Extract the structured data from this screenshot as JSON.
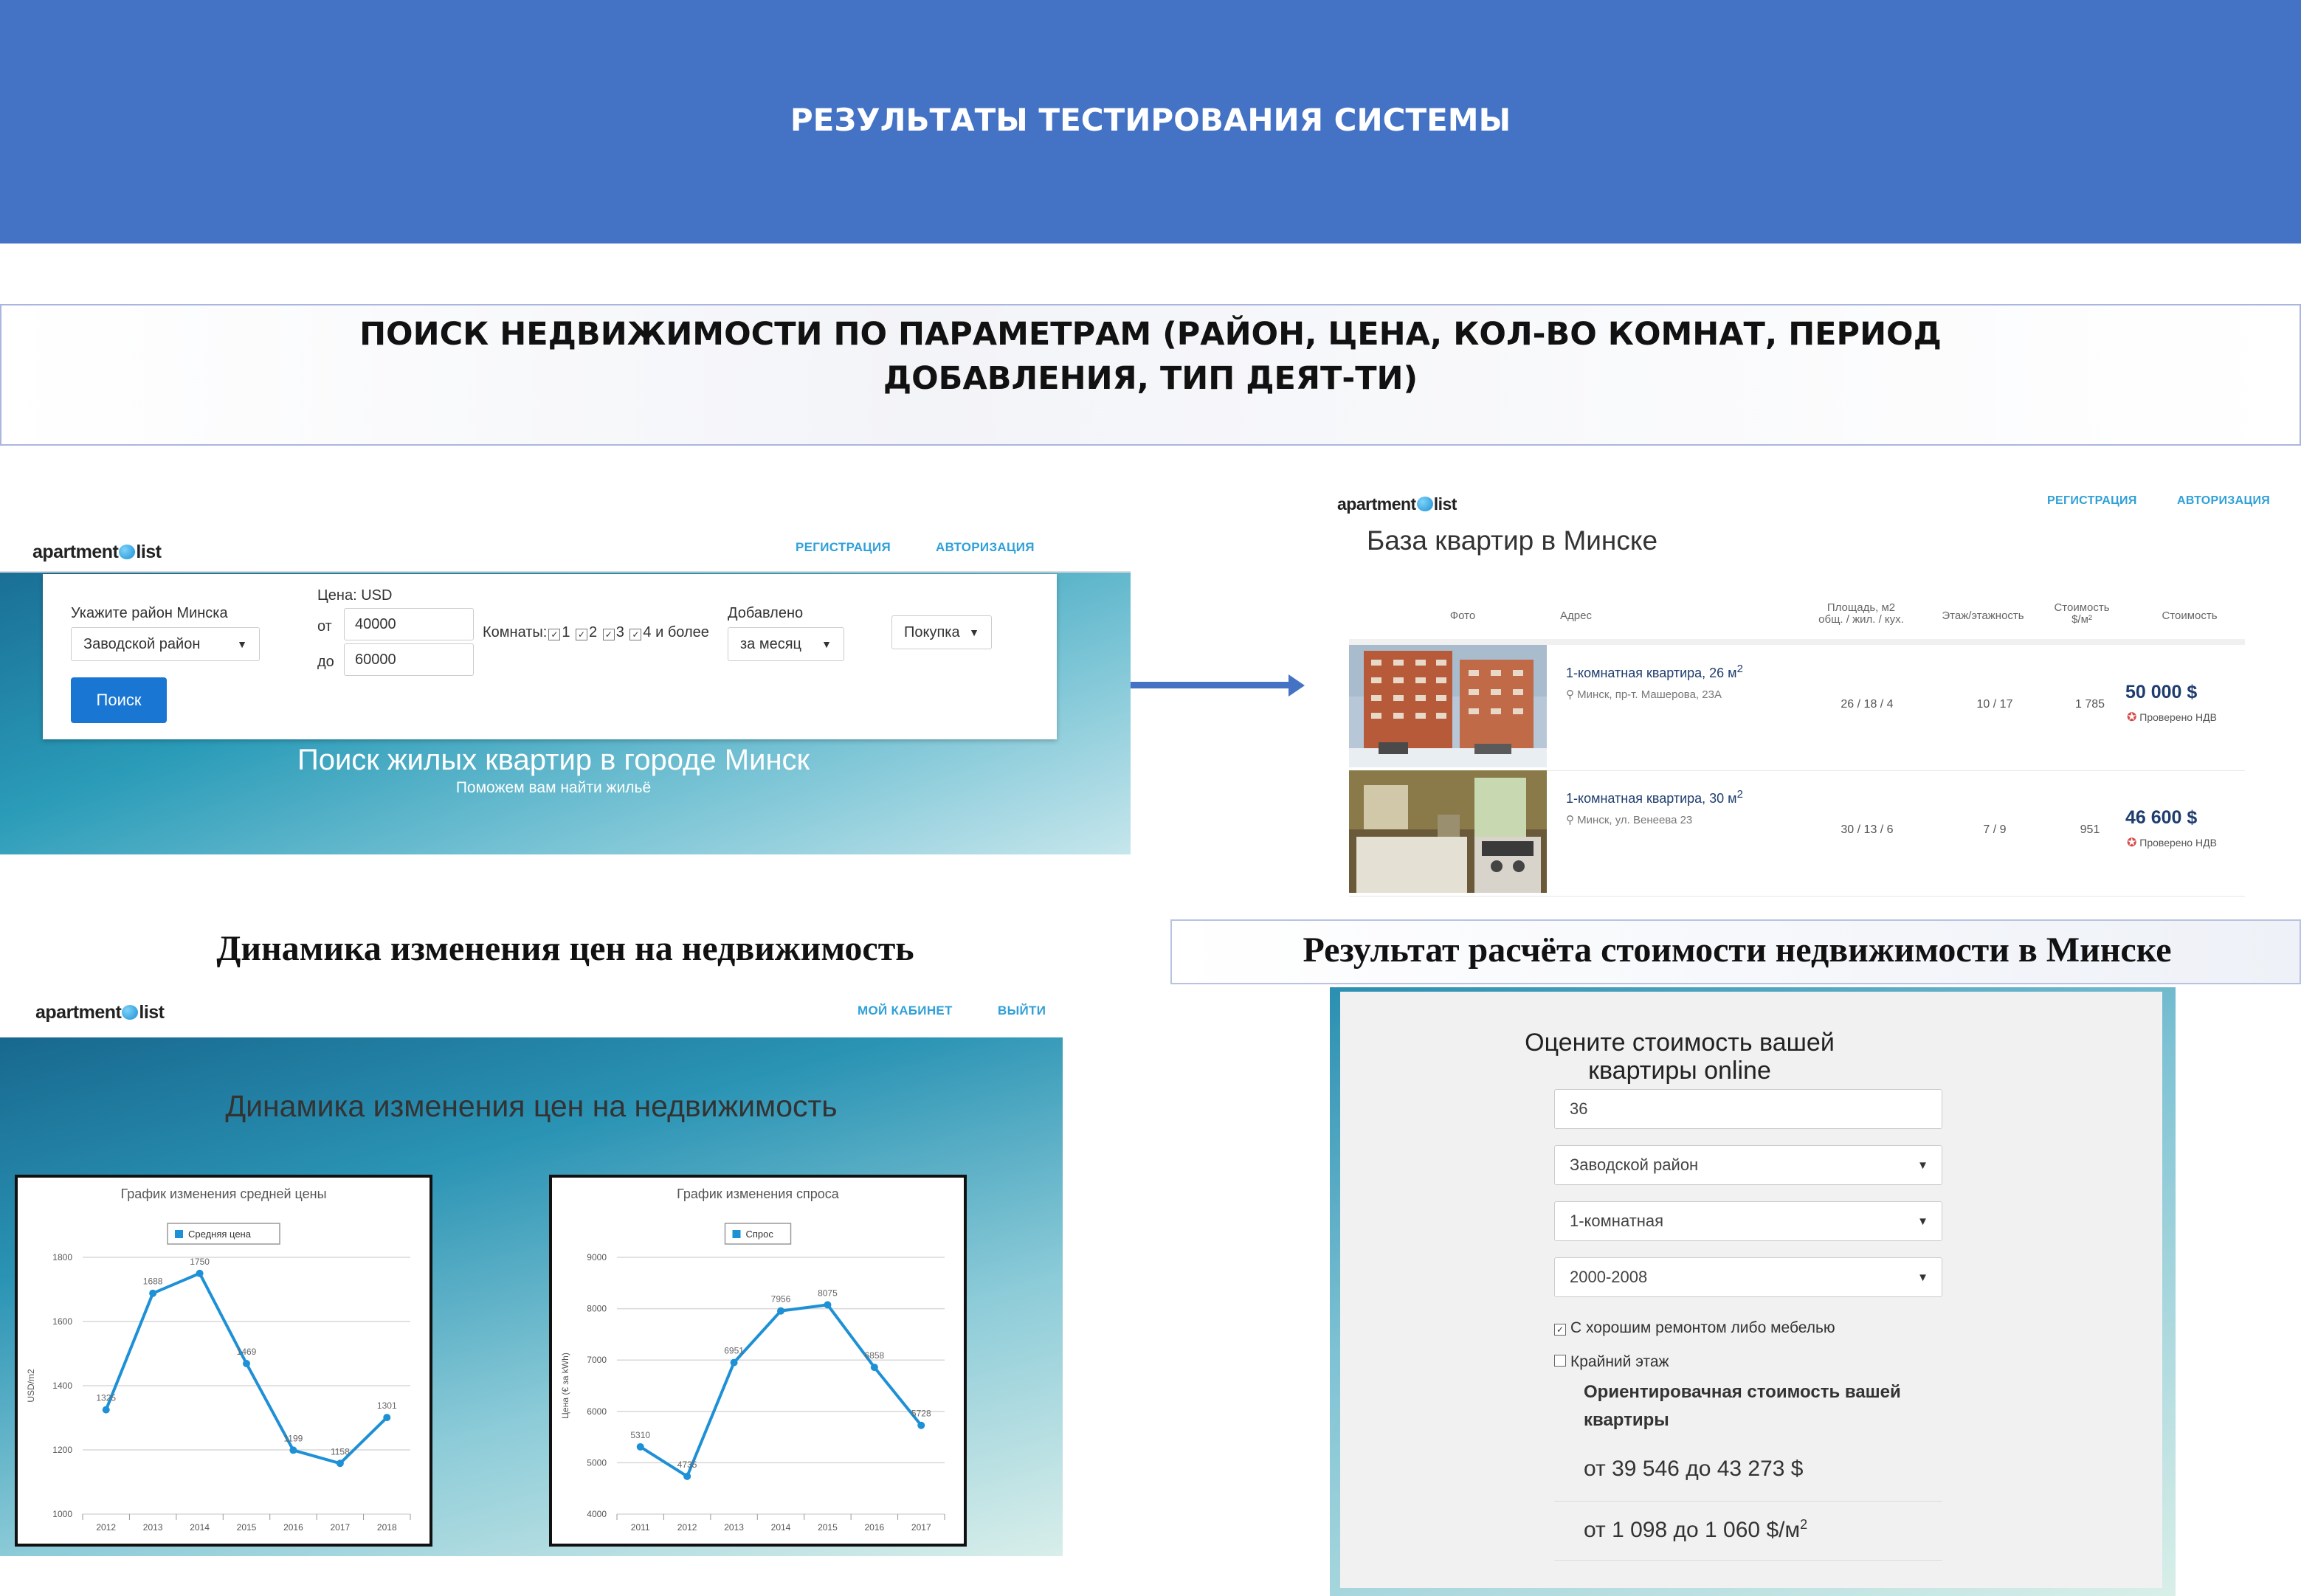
{
  "banner": {
    "title": "РЕЗУЛЬТАТЫ ТЕСТИРОВАНИЯ СИСТЕМЫ"
  },
  "subtitle": {
    "line1": "ПОИСК НЕДВИЖИМОСТИ ПО ПАРАМЕТРАМ (РАЙОН, ЦЕНА, КОЛ-ВО КОМНАТ, ПЕРИОД",
    "line2": "ДОБАВЛЕНИЯ, ТИП ДЕЯТ-ТИ)"
  },
  "brand": {
    "word1": "apartment",
    "word2": "list"
  },
  "search_panel": {
    "nav": {
      "register": "РЕГИСТРАЦИЯ",
      "login": "АВТОРИЗАЦИЯ"
    },
    "district_label": "Укажите район Минска",
    "district_value": "Заводской район",
    "price_label": "Цена: USD",
    "from_label": "от",
    "from_value": "40000",
    "to_label": "до",
    "to_value": "60000",
    "rooms_label": "Комнаты:",
    "rooms_options": [
      "1",
      "2",
      "3",
      "4 и более"
    ],
    "added_label": "Добавлено",
    "added_value": "за месяц",
    "deal_value": "Покупка",
    "search_button": "Поиск",
    "hero_title": "Поиск жилых квартир в городе Минск",
    "hero_subtitle": "Поможем вам найти жильё"
  },
  "listing_panel": {
    "nav": {
      "register": "РЕГИСТРАЦИЯ",
      "login": "АВТОРИЗАЦИЯ"
    },
    "heading": "База квартир в Минске",
    "columns": {
      "photo": "Фото",
      "address": "Адрес",
      "area_1": "Площадь, м2",
      "area_2": "общ. / жил. / кух.",
      "floor": "Этаж/этажность",
      "ppm_1": "Стоимость",
      "ppm_2": "$/м²",
      "price": "Стоимость"
    },
    "rows": [
      {
        "title": "1-комнатная квартира, 26 м",
        "address": "Минск, пр-т. Машерова, 23А",
        "area": "26 / 18 / 4",
        "floor": "10 / 17",
        "ppm": "1 785",
        "price": "50 000 $",
        "badge": "Проверено НДВ"
      },
      {
        "title": "1-комнатная квартира, 30 м",
        "address": "Минск, ул. Венеева 23",
        "area": "30 / 13 / 6",
        "floor": "7 / 9",
        "ppm": "951",
        "price": "46 600 $",
        "badge": "Проверено НДВ"
      }
    ],
    "sup": "2"
  },
  "section_titles": {
    "dynamics": "Динамика изменения цен на недвижимость",
    "calc": "Результат расчёта стоимости недвижимости в Минске"
  },
  "charts_panel": {
    "nav": {
      "cabinet": "МОЙ КАБИНЕТ",
      "logout": "ВЫЙТИ"
    },
    "title": "Динамика изменения цен на недвижимость"
  },
  "chart_data": [
    {
      "type": "line",
      "title": "График изменения средней цены",
      "legend": "Средняя цена",
      "ylabel": "USD/m2",
      "x": [
        "2012",
        "2013",
        "2014",
        "2015",
        "2016",
        "2017",
        "2018"
      ],
      "series": [
        {
          "name": "Средняя цена",
          "values": [
            1325,
            1688,
            1750,
            1469,
            1199,
            1158,
            1301
          ]
        }
      ],
      "ylim": [
        1000,
        1800
      ],
      "yticks": [
        "1000",
        "1200",
        "1400",
        "1600",
        "1800"
      ],
      "grid": true,
      "color": "#1e90d6"
    },
    {
      "type": "line",
      "title": "График изменения спроса",
      "legend": "Спрос",
      "ylabel": "Цена (€ за kWh)",
      "x": [
        "2011",
        "2012",
        "2013",
        "2014",
        "2015",
        "2016",
        "2017"
      ],
      "series": [
        {
          "name": "Спрос",
          "values": [
            5310,
            4735,
            6951,
            7956,
            8075,
            6858,
            5728
          ]
        }
      ],
      "ylim": [
        4000,
        9000
      ],
      "yticks": [
        "4000",
        "5000",
        "6000",
        "7000",
        "8000",
        "9000"
      ],
      "grid": true,
      "color": "#1e90d6"
    }
  ],
  "calc_panel": {
    "title_line1": "Оцените стоимость вашей",
    "title_line2": "квартиры online",
    "area_value": "36",
    "district_value": "Заводской район",
    "rooms_value": "1-комнатная",
    "years_value": "2000-2008",
    "repair_label": "С хорошим ремонтом либо мебелью",
    "last_floor_label": "Крайний этаж",
    "result_label_line1": "Ориентировачная стоимость вашей",
    "result_label_line2": "квартиры",
    "result_total": "от 39 546 до 43 273 $",
    "result_ppm": "от 1 098 до 1 060 $/м",
    "result_ppm_sup": "2"
  },
  "colors": {
    "banner": "#4472c4",
    "accent": "#2fa0d8",
    "button": "#1976d2",
    "series": "#1e90d6"
  }
}
